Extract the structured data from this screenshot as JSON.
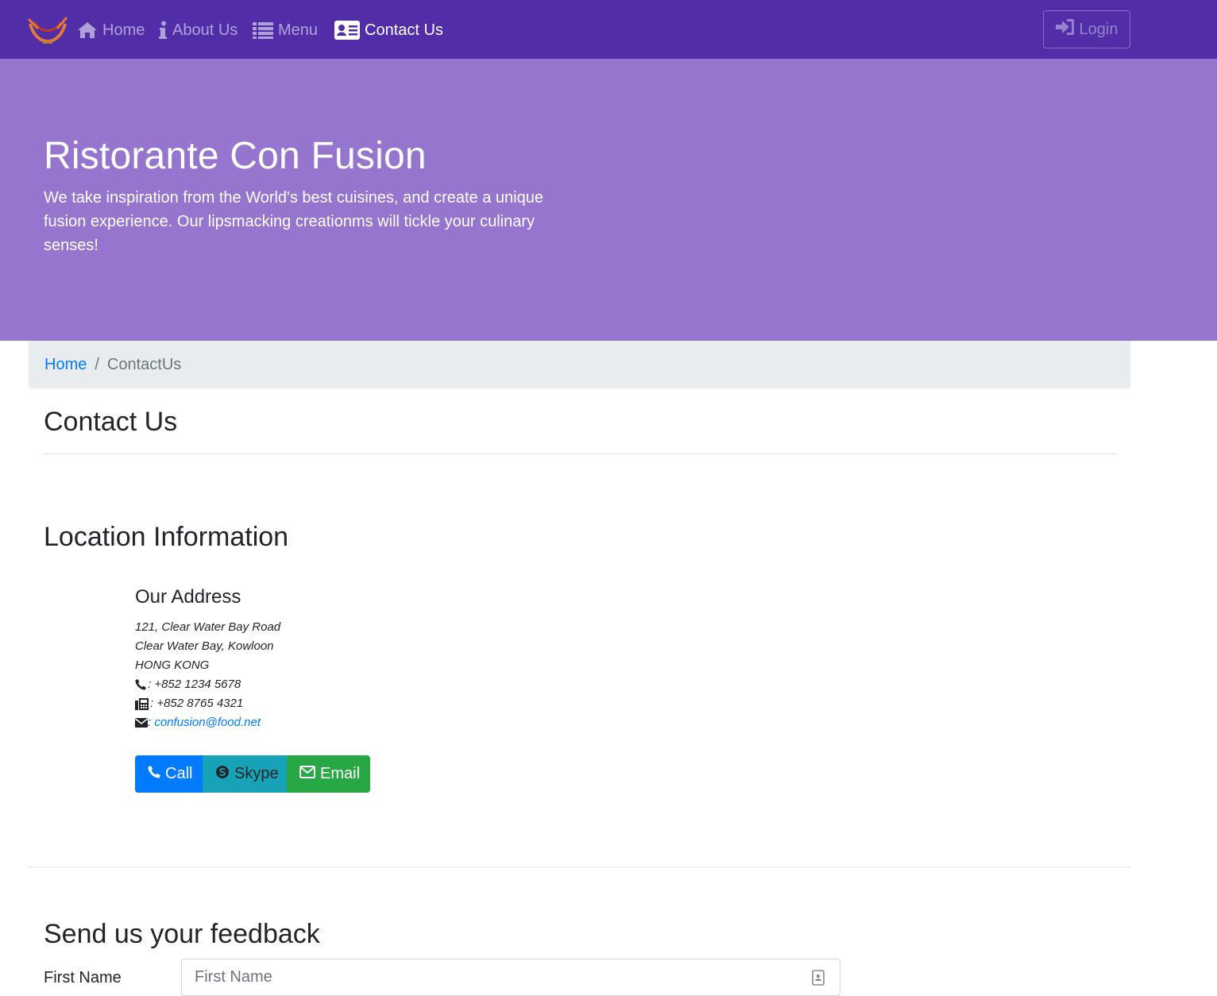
{
  "navbar": {
    "items": [
      {
        "label": "Home",
        "icon": "home-icon"
      },
      {
        "label": "About Us",
        "icon": "info-icon"
      },
      {
        "label": "Menu",
        "icon": "list-icon"
      },
      {
        "label": "Contact Us",
        "icon": "address-card-icon"
      }
    ],
    "login_label": "Login",
    "colors": {
      "background": "#512da8",
      "active": "#ffffff",
      "inactive": "rgba(255,255,255,0.55)"
    }
  },
  "jumbotron": {
    "title": "Ristorante Con Fusion",
    "subtitle": "We take inspiration from the World's best cuisines, and create a unique fusion experience. Our lipsmacking creationms will tickle your culinary senses!",
    "color": "#9575cd"
  },
  "breadcrumb": {
    "home": "Home",
    "separator": "/",
    "current": "ContactUs"
  },
  "page": {
    "title": "Contact Us"
  },
  "location": {
    "title": "Location Information",
    "address_title": "Our Address",
    "lines": [
      "121, Clear Water Bay Road",
      "Clear Water Bay, Kowloon",
      "HONG KONG"
    ],
    "phone": ": +852 1234 5678",
    "fax": ": +852 8765 4321",
    "email_prefix": ": ",
    "email": "confusion@food.net"
  },
  "actions": {
    "call": "Call",
    "skype": "Skype",
    "email": "Email",
    "colors": {
      "call": "#007bff",
      "skype": "#17a2b8",
      "email": "#28a745"
    }
  },
  "feedback": {
    "title": "Send us your feedback",
    "first_name_label": "First Name",
    "first_name_placeholder": "First Name",
    "first_name_value": ""
  }
}
